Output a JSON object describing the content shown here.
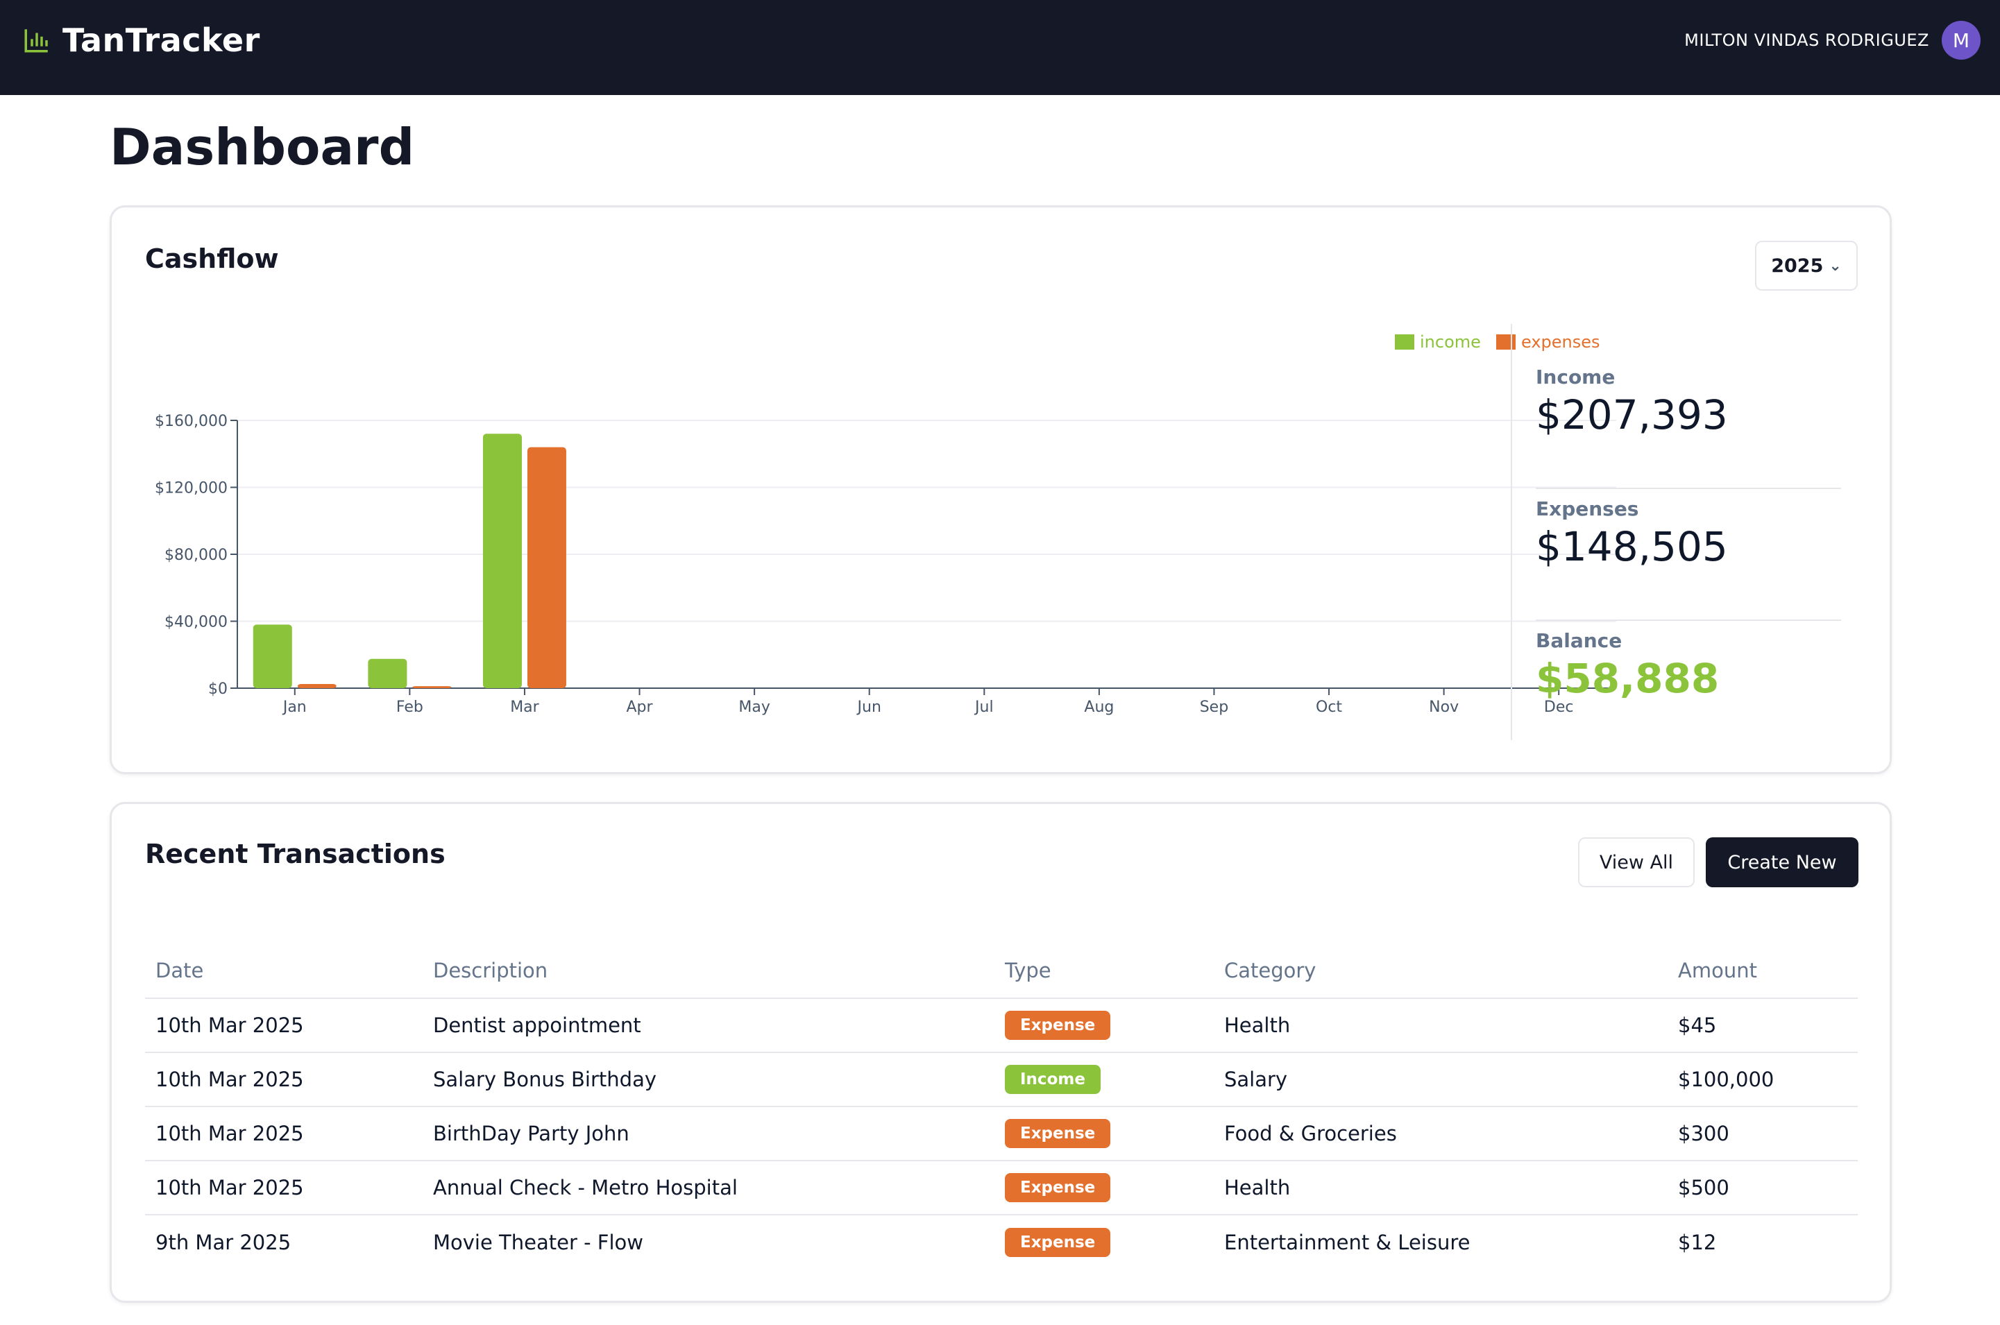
{
  "app": {
    "name": "TanTracker",
    "logo_icon": "bar-chart-icon",
    "accent": "#8bc33a"
  },
  "user": {
    "name": "MILTON VINDAS RODRIGUEZ",
    "initial": "M"
  },
  "page_title": "Dashboard",
  "cashflow": {
    "title": "Cashflow",
    "year": "2025",
    "stats": [
      {
        "label": "Income",
        "value": "$207,393"
      },
      {
        "label": "Expenses",
        "value": "$148,505"
      },
      {
        "label": "Balance",
        "value": "$58,888"
      }
    ]
  },
  "chart_data": {
    "type": "bar",
    "categories": [
      "Jan",
      "Feb",
      "Mar",
      "Apr",
      "May",
      "Jun",
      "Jul",
      "Aug",
      "Sep",
      "Oct",
      "Nov",
      "Dec"
    ],
    "series": [
      {
        "name": "income",
        "color": "#8bc33a",
        "values": [
          38000,
          17500,
          152000,
          0,
          0,
          0,
          0,
          0,
          0,
          0,
          0,
          0
        ]
      },
      {
        "name": "expenses",
        "color": "#e3712d",
        "values": [
          2500,
          1200,
          144000,
          0,
          0,
          0,
          0,
          0,
          0,
          0,
          0,
          0
        ]
      }
    ],
    "ylim": [
      0,
      160000
    ],
    "yticks": [
      0,
      40000,
      80000,
      120000,
      160000
    ],
    "ytick_labels": [
      "$0",
      "$40,000",
      "$80,000",
      "$120,000",
      "$160,000"
    ],
    "grid": true,
    "legend": "top-right"
  },
  "recent": {
    "title": "Recent Transactions",
    "view_all_label": "View All",
    "create_label": "Create New",
    "columns": [
      "Date",
      "Description",
      "Type",
      "Category",
      "Amount"
    ],
    "rows": [
      {
        "date": "10th Mar 2025",
        "description": "Dentist appointment",
        "type": "Expense",
        "category": "Health",
        "amount": "$45"
      },
      {
        "date": "10th Mar 2025",
        "description": "Salary Bonus Birthday",
        "type": "Income",
        "category": "Salary",
        "amount": "$100,000"
      },
      {
        "date": "10th Mar 2025",
        "description": "BirthDay Party John",
        "type": "Expense",
        "category": "Food & Groceries",
        "amount": "$300"
      },
      {
        "date": "10th Mar 2025",
        "description": "Annual Check - Metro Hospital",
        "type": "Expense",
        "category": "Health",
        "amount": "$500"
      },
      {
        "date": "9th Mar 2025",
        "description": "Movie Theater - Flow",
        "type": "Expense",
        "category": "Entertainment & Leisure",
        "amount": "$12"
      }
    ]
  }
}
